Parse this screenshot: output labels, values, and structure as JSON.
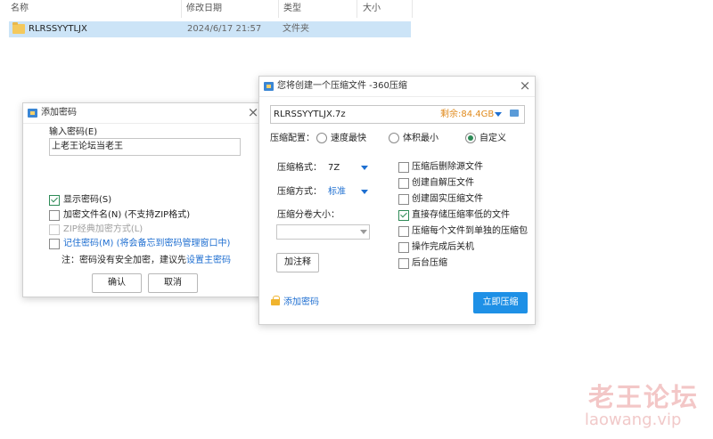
{
  "explorer": {
    "columns": [
      "名称",
      "修改日期",
      "类型",
      "大小"
    ],
    "row": {
      "name": "RLRSSYYTLJX",
      "date": "2024/6/17 21:57",
      "type": "文件夹",
      "size": ""
    }
  },
  "password_dialog": {
    "title": "添加密码",
    "input_label": "输入密码(E)",
    "input_value": "上老王论坛当老王",
    "options": [
      {
        "label": "显示密码(S)",
        "checked": true,
        "disabled": false
      },
      {
        "label": "加密文件名(N) (不支持ZIP格式)",
        "checked": false,
        "disabled": false
      },
      {
        "label": "ZIP经典加密方式(L)",
        "checked": false,
        "disabled": true
      },
      {
        "label": "记住密码(M) (将会备忘到密码管理窗口中)",
        "checked": false,
        "disabled": false
      }
    ],
    "note_prefix": "注：密码没有安全加密，建议先",
    "note_link": "设置主密码",
    "ok_label": "确认",
    "cancel_label": "取消"
  },
  "compress_dialog": {
    "title": "您将创建一个压缩文件 -360压缩",
    "filename": "RLRSSYYTLJX.7z",
    "free_space": "剩余:84.4GB",
    "config_label": "压缩配置：",
    "config_options": [
      {
        "label": "速度最快",
        "selected": false
      },
      {
        "label": "体积最小",
        "selected": false
      },
      {
        "label": "自定义",
        "selected": true
      }
    ],
    "format_label": "压缩格式：",
    "format_value": "7Z",
    "method_label": "压缩方式：",
    "method_value": "标准",
    "split_label": "压缩分卷大小：",
    "split_value": "",
    "comment_button": "加注释",
    "options": [
      {
        "label": "压缩后删除源文件",
        "checked": false
      },
      {
        "label": "创建自解压文件",
        "checked": false
      },
      {
        "label": "创建固实压缩文件",
        "checked": false
      },
      {
        "label": "直接存储压缩率低的文件",
        "checked": true
      },
      {
        "label": "压缩每个文件到单独的压缩包",
        "checked": false
      },
      {
        "label": "操作完成后关机",
        "checked": false
      },
      {
        "label": "后台压缩",
        "checked": false
      }
    ],
    "add_password_link": "添加密码",
    "compress_button": "立即压缩"
  },
  "watermark": {
    "cn": "老王论坛",
    "en": "laowang.vip"
  },
  "colors": {
    "accent": "#1e90e6",
    "selection": "#cce4f7",
    "check": "#2e8b57"
  }
}
